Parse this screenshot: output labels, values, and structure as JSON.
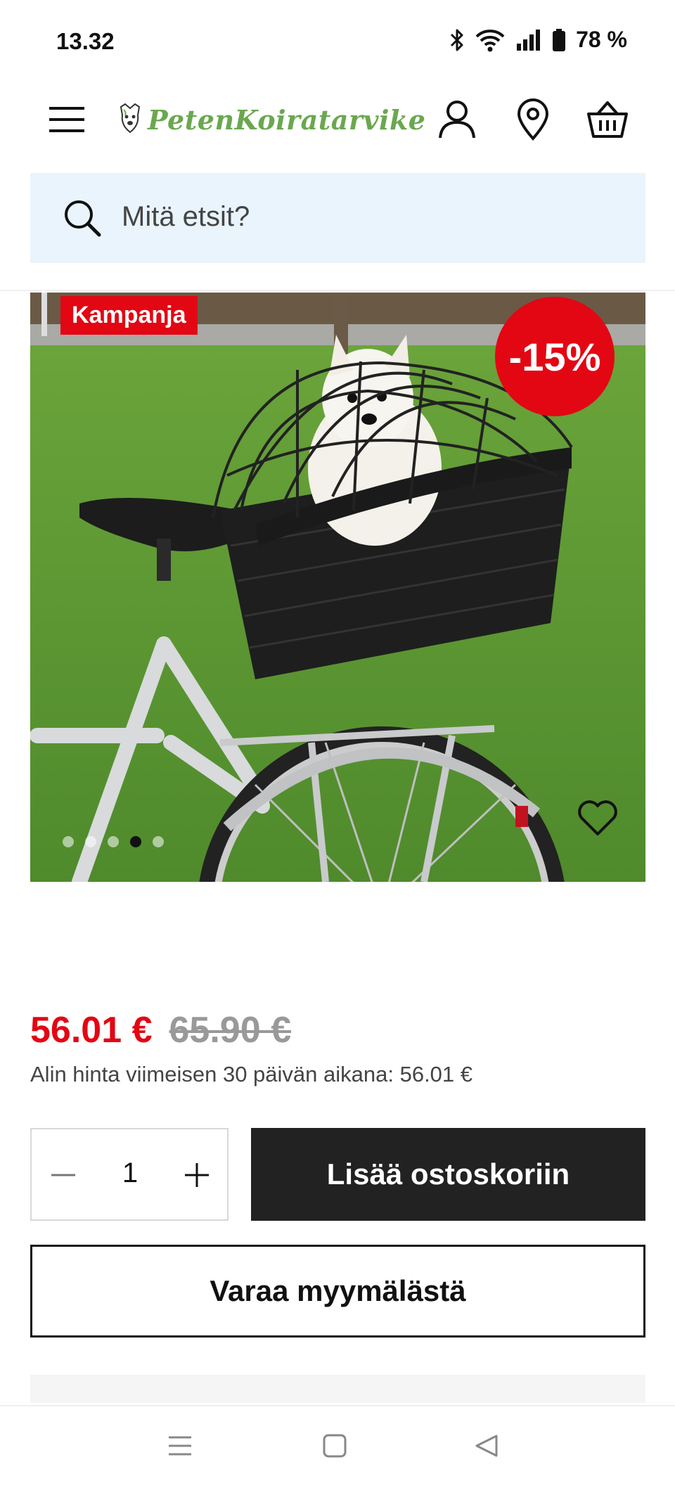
{
  "status_bar": {
    "time": "13.32",
    "battery": "78 %",
    "icons": [
      "bluetooth-icon",
      "wifi-icon",
      "signal-icon",
      "battery-icon"
    ]
  },
  "header": {
    "logo_text": "PetenKoiratarvike",
    "icons": [
      "menu-icon",
      "user-icon",
      "location-icon",
      "basket-icon"
    ]
  },
  "search": {
    "placeholder": "Mitä etsit?"
  },
  "product": {
    "campaign_label": "Kampanja",
    "discount_label": "-15%",
    "image_description_icons": [
      "heart-icon"
    ],
    "carousel": {
      "slide_count": 5,
      "active_index": 3
    },
    "price_current": "56.01 €",
    "price_old": "65.90 €",
    "lowest_price_text": "Alin hinta viimeisen 30 päivän aikana: 56.01 €",
    "quantity": "1",
    "add_to_cart_label": "Lisää ostoskoriin",
    "reserve_label": "Varaa myymälästä"
  },
  "colors": {
    "brand_green": "#6aa84f",
    "sale_red": "#e30613",
    "search_bg": "#e9f4fc",
    "button_dark": "#222222"
  },
  "nav_bar": {
    "buttons": [
      "recent-apps-icon",
      "home-icon",
      "back-icon"
    ]
  }
}
